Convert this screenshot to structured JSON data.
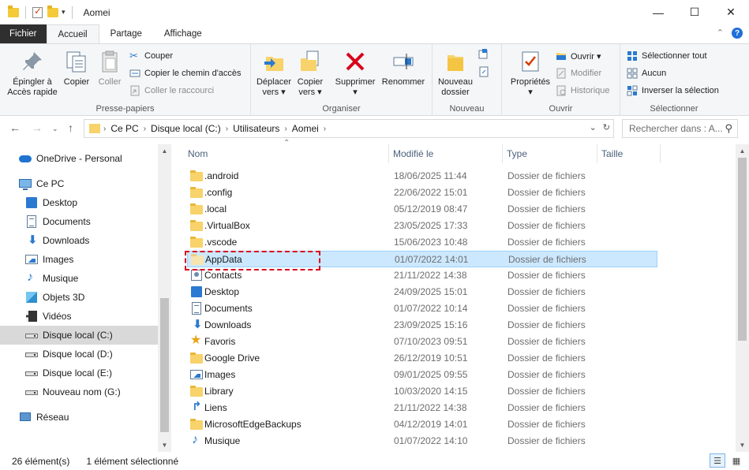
{
  "window": {
    "title": "Aomei",
    "minimize": "—",
    "maximize": "☐",
    "close": "✕"
  },
  "tabs": [
    {
      "label": "Fichier"
    },
    {
      "label": "Accueil"
    },
    {
      "label": "Partage"
    },
    {
      "label": "Affichage"
    }
  ],
  "ribbon": {
    "groups": {
      "clipboard": "Presse-papiers",
      "organize": "Organiser",
      "new": "Nouveau",
      "open": "Ouvrir",
      "select": "Sélectionner"
    },
    "pin_line1": "Épingler à",
    "pin_line2": "Accès rapide",
    "copy": "Copier",
    "paste": "Coller",
    "cut": "Couper",
    "copy_path": "Copier le chemin d'accès",
    "paste_shortcut": "Coller le raccourci",
    "move_line1": "Déplacer",
    "move_line2": "vers ▾",
    "copyto_line1": "Copier",
    "copyto_line2": "vers ▾",
    "delete_line1": "Supprimer",
    "delete_line2": "▾",
    "rename": "Renommer",
    "newfolder_line1": "Nouveau",
    "newfolder_line2": "dossier",
    "properties_line1": "Propriétés",
    "properties_line2": "▾",
    "open": "Ouvrir ▾",
    "edit": "Modifier",
    "history": "Historique",
    "select_all": "Sélectionner tout",
    "select_none": "Aucun",
    "invert_selection": "Inverser la sélection"
  },
  "address": {
    "crumbs": [
      "Ce PC",
      "Disque local (C:)",
      "Utilisateurs",
      "Aomei"
    ],
    "search_placeholder": "Rechercher dans : A..."
  },
  "nav": {
    "items": [
      {
        "label": "OneDrive - Personal",
        "icon": "cloud-icon"
      },
      {
        "label": "Ce PC",
        "icon": "pc-icon"
      },
      {
        "label": "Desktop",
        "icon": "desktop-icon"
      },
      {
        "label": "Documents",
        "icon": "documents-icon"
      },
      {
        "label": "Downloads",
        "icon": "downloads-icon"
      },
      {
        "label": "Images",
        "icon": "images-icon"
      },
      {
        "label": "Musique",
        "icon": "music-icon"
      },
      {
        "label": "Objets 3D",
        "icon": "objects3d-icon"
      },
      {
        "label": "Vidéos",
        "icon": "videos-icon"
      },
      {
        "label": "Disque local (C:)",
        "icon": "drive-icon"
      },
      {
        "label": "Disque local (D:)",
        "icon": "drive-icon"
      },
      {
        "label": "Disque local (E:)",
        "icon": "drive-icon"
      },
      {
        "label": "Nouveau nom (G:)",
        "icon": "drive-icon"
      },
      {
        "label": "Réseau",
        "icon": "network-icon"
      }
    ]
  },
  "columns": {
    "name": "Nom",
    "modified": "Modifié le",
    "type": "Type",
    "size": "Taille"
  },
  "files": [
    {
      "name": ".android",
      "date": "18/06/2025 11:44",
      "type": "Dossier de fichiers",
      "icon": "folder-icon"
    },
    {
      "name": ".config",
      "date": "22/06/2022 15:01",
      "type": "Dossier de fichiers",
      "icon": "folder-icon"
    },
    {
      "name": ".local",
      "date": "05/12/2019 08:47",
      "type": "Dossier de fichiers",
      "icon": "folder-icon"
    },
    {
      "name": ".VirtualBox",
      "date": "23/05/2025 17:33",
      "type": "Dossier de fichiers",
      "icon": "folder-icon"
    },
    {
      "name": ".vscode",
      "date": "15/06/2023 10:48",
      "type": "Dossier de fichiers",
      "icon": "folder-icon"
    },
    {
      "name": "AppData",
      "date": "01/07/2022 14:01",
      "type": "Dossier de fichiers",
      "icon": "folder-icon"
    },
    {
      "name": "Contacts",
      "date": "21/11/2022 14:38",
      "type": "Dossier de fichiers",
      "icon": "contacts-icon"
    },
    {
      "name": "Desktop",
      "date": "24/09/2025 15:01",
      "type": "Dossier de fichiers",
      "icon": "desktop-icon"
    },
    {
      "name": "Documents",
      "date": "01/07/2022 10:14",
      "type": "Dossier de fichiers",
      "icon": "documents-icon"
    },
    {
      "name": "Downloads",
      "date": "23/09/2025 15:16",
      "type": "Dossier de fichiers",
      "icon": "downloads-icon"
    },
    {
      "name": "Favoris",
      "date": "07/10/2023 09:51",
      "type": "Dossier de fichiers",
      "icon": "star-icon"
    },
    {
      "name": "Google Drive",
      "date": "26/12/2019 10:51",
      "type": "Dossier de fichiers",
      "icon": "folder-icon"
    },
    {
      "name": "Images",
      "date": "09/01/2025 09:55",
      "type": "Dossier de fichiers",
      "icon": "images-icon"
    },
    {
      "name": "Library",
      "date": "10/03/2020 14:15",
      "type": "Dossier de fichiers",
      "icon": "folder-icon"
    },
    {
      "name": "Liens",
      "date": "21/11/2022 14:38",
      "type": "Dossier de fichiers",
      "icon": "links-icon"
    },
    {
      "name": "MicrosoftEdgeBackups",
      "date": "04/12/2019 14:01",
      "type": "Dossier de fichiers",
      "icon": "folder-icon"
    },
    {
      "name": "Musique",
      "date": "01/07/2022 14:10",
      "type": "Dossier de fichiers",
      "icon": "music-icon"
    }
  ],
  "selected_file": "AppData",
  "status": {
    "count": "26 élément(s)",
    "selection": "1 élément sélectionné"
  },
  "colors": {
    "selection_bg": "#cce8ff",
    "highlight_border": "#d9001b",
    "folder": "#f8d26a"
  }
}
